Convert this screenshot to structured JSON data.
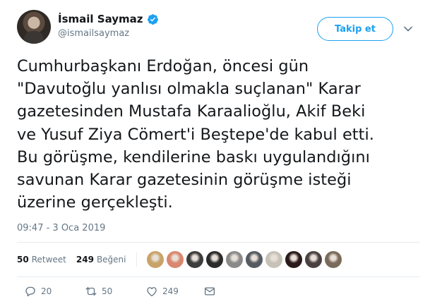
{
  "tweet": {
    "author": {
      "display_name": "İsmail Saymaz",
      "handle": "@ismailsaymaz",
      "verified": true
    },
    "follow_label": "Takip et",
    "text_lines": [
      "Cumhurbaşkanı Erdoğan, öncesi gün",
      "\"Davutoğlu yanlısı olmakla suçlanan\" Karar",
      "gazetesinden Mustafa Karaalioğlu, Akif Beki",
      "ve Yusuf Ziya Cömert'i Beştepe'de kabul etti.",
      "Bu görüşme, kendilerine baskı uygulandığını",
      "savunan Karar gazetesinin görüşme isteği",
      "üzerine gerçekleşti."
    ],
    "timestamp": "09:47 - 3 Oca 2019",
    "stats": {
      "retweets_count": "50",
      "retweets_label": "Retweet",
      "likes_count": "249",
      "likes_label": "Beğeni"
    },
    "likers": [
      {
        "color": "#c8a46a"
      },
      {
        "color": "#d9876e"
      },
      {
        "color": "#3c3c3c"
      },
      {
        "color": "#2b2b2b"
      },
      {
        "color": "#8a8a8a"
      },
      {
        "color": "#555b61"
      },
      {
        "color": "#c7c2b8"
      },
      {
        "color": "#2a1a1a"
      },
      {
        "color": "#4a4040"
      },
      {
        "color": "#7a6a5a"
      }
    ],
    "actions": {
      "reply_count": "20",
      "retweet_count": "50",
      "like_count": "249"
    },
    "colors": {
      "accent": "#1da1f2",
      "text": "#14171a",
      "secondary": "#657786",
      "divider": "#e6ecf0"
    }
  }
}
